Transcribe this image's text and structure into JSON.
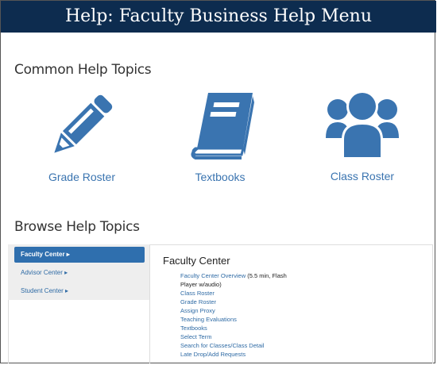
{
  "header": {
    "title": "Help: Faculty Business Help Menu"
  },
  "common": {
    "title": "Common Help Topics",
    "items": [
      {
        "label": "Grade Roster",
        "icon": "pencil-icon"
      },
      {
        "label": "Textbooks",
        "icon": "book-icon"
      },
      {
        "label": "Class Roster",
        "icon": "users-icon"
      }
    ]
  },
  "browse": {
    "title": "Browse Help Topics",
    "nav": [
      {
        "label": "Faculty Center ▸",
        "active": true
      },
      {
        "label": "Advisor Center ▸",
        "active": false
      },
      {
        "label": "Student Center ▸",
        "active": false
      }
    ],
    "content_title": "Faculty Center",
    "links": {
      "overview": "Faculty Center Overview",
      "overview_note": " (5.5 min, Flash Player w/audio)",
      "items": [
        "Class Roster",
        "Grade Roster",
        "Assign Proxy",
        "Teaching Evaluations",
        "Textbooks",
        "Select Term",
        "Search for Classes/Class Detail",
        "Late Drop/Add Requests"
      ]
    }
  },
  "colors": {
    "header_bg": "#0d2c4f",
    "accent": "#3a74b0"
  }
}
